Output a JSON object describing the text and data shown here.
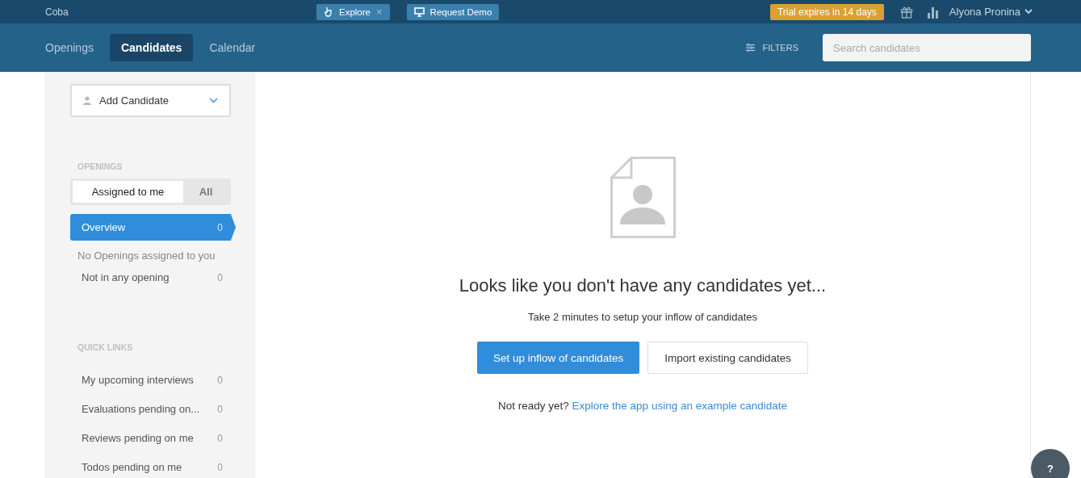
{
  "topbar": {
    "brand": "Coba",
    "explore": {
      "label": "Explore",
      "close": "×"
    },
    "demo": "Request Demo",
    "trial": "Trial expires in 14 days",
    "user": "Alyona Pronina"
  },
  "nav": {
    "tabs": [
      {
        "label": "Openings",
        "selected": false
      },
      {
        "label": "Candidates",
        "selected": true
      },
      {
        "label": "Calendar",
        "selected": false
      }
    ],
    "filters": "FILTERS",
    "search": {
      "placeholder": "Search candidates"
    }
  },
  "sidebar": {
    "add_button": "Add Candidate",
    "openings_heading": "OPENINGS",
    "segments": [
      {
        "label": "Assigned to me",
        "selected": true
      },
      {
        "label": "All",
        "selected": false
      }
    ],
    "opening_items": [
      {
        "label": "Overview",
        "count": "0",
        "selected": true
      }
    ],
    "empty_note": "No Openings assigned to you",
    "other_items": [
      {
        "label": "Not in any opening",
        "count": "0",
        "selected": false
      }
    ],
    "quick_links_heading": "QUICK LINKS",
    "quick_links": [
      {
        "label": "My upcoming interviews",
        "count": "0"
      },
      {
        "label": "Evaluations pending on...",
        "count": "0"
      },
      {
        "label": "Reviews pending on me",
        "count": "0"
      },
      {
        "label": "Todos pending on me",
        "count": "0"
      }
    ]
  },
  "empty_state": {
    "title": "Looks like you don't have any candidates yet...",
    "subtitle": "Take 2 minutes to setup your inflow of candidates",
    "primary_button": "Set up inflow of candidates",
    "secondary_button": "Import existing candidates",
    "prompt": "Not ready yet?",
    "link": "Explore the app using an example candidate"
  },
  "help": "?"
}
